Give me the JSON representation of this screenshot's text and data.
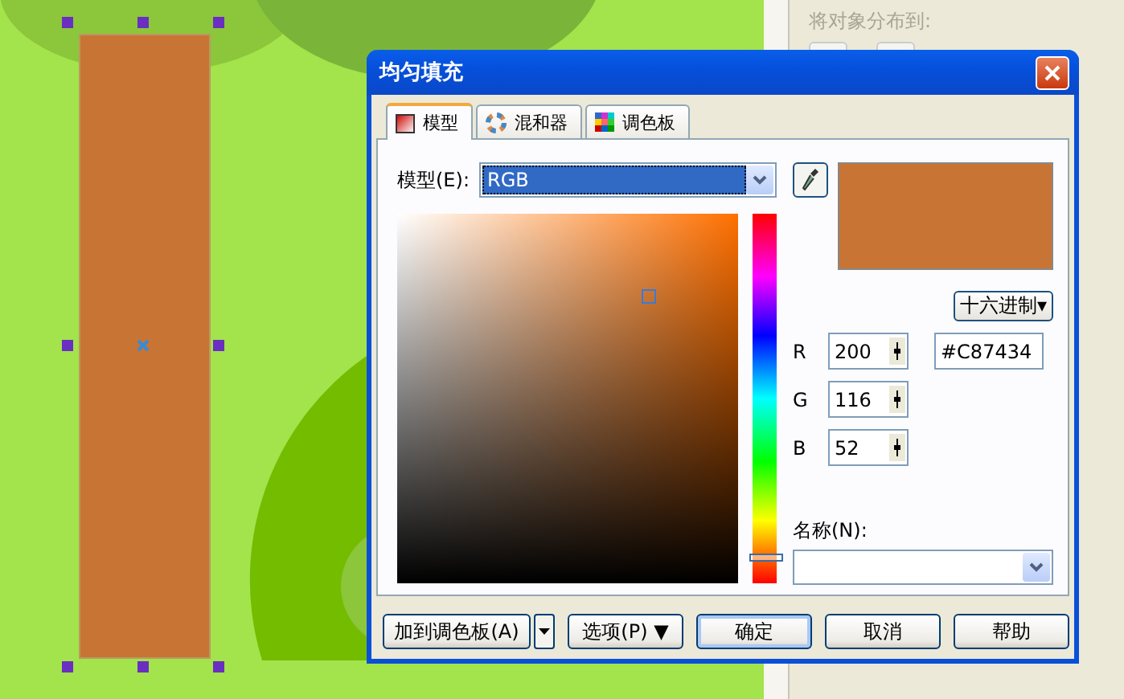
{
  "docker": {
    "label": "将对象分布到:"
  },
  "dialog": {
    "title": "均匀填充",
    "tabs": [
      {
        "label": "模型",
        "kind": "model",
        "selected": true
      },
      {
        "label": "混和器",
        "kind": "mixer",
        "selected": false
      },
      {
        "label": "调色板",
        "kind": "palette",
        "selected": false
      }
    ],
    "model_label": "模型(E):",
    "model_select": {
      "value": "RGB"
    },
    "hue_slider": {
      "level": 0.07
    },
    "format_button": "十六进制▾",
    "channels": [
      {
        "label": "R",
        "value": "200"
      },
      {
        "label": "G",
        "value": "116"
      },
      {
        "label": "B",
        "value": "52"
      }
    ],
    "hex_field": {
      "value": "#C87434"
    },
    "name_label": "名称(N):",
    "buttons": [
      {
        "label": "加到调色板(A)",
        "kind": "split"
      },
      {
        "label": "选项(P) ▼",
        "kind": "menu"
      },
      {
        "label": "确定",
        "kind": "default"
      },
      {
        "label": "取消",
        "kind": "plain"
      },
      {
        "label": "帮助",
        "kind": "plain"
      }
    ]
  }
}
